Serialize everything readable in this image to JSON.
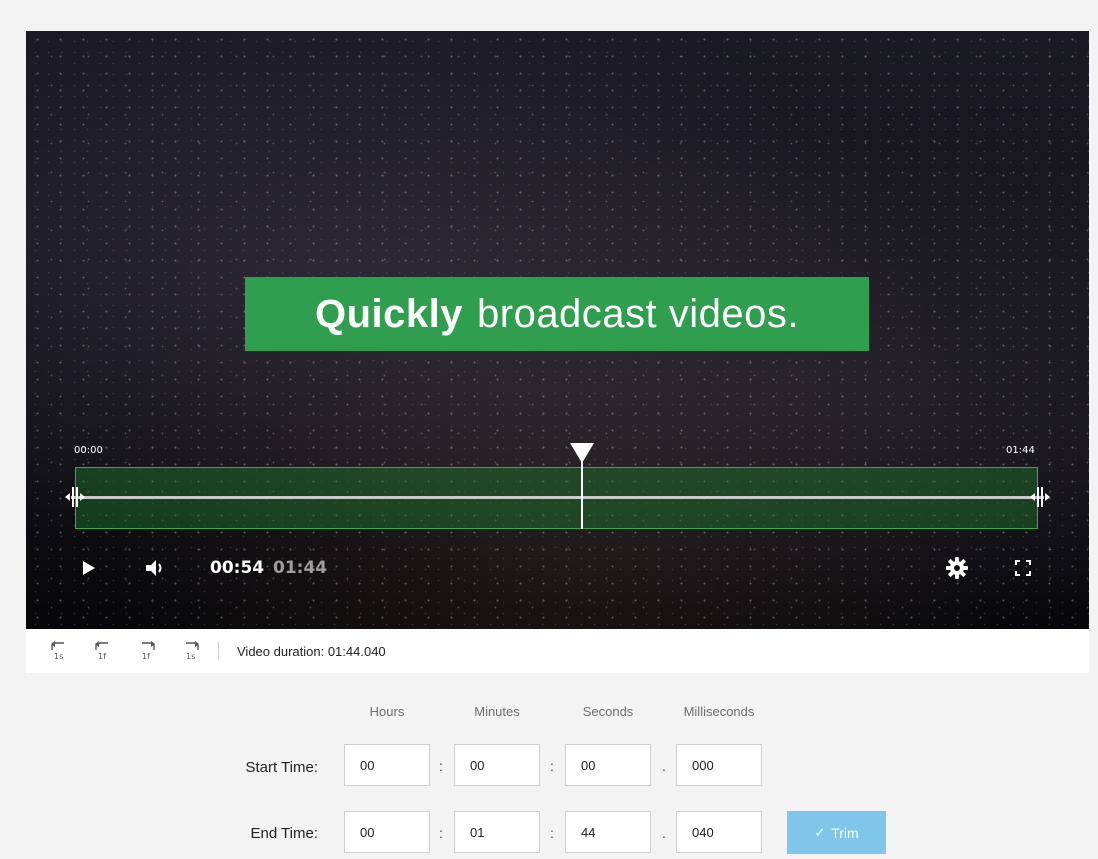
{
  "video": {
    "caption_bold": "Quickly",
    "caption_rest": "broadcast videos.",
    "trim_start_label": "00:00",
    "trim_end_label": "01:44",
    "playhead_fraction": 0.53,
    "current_time": "00:54",
    "total_time": "01:44"
  },
  "controls": {
    "icons": [
      "play-icon",
      "volume-icon",
      "settings-icon",
      "fullscreen-icon"
    ]
  },
  "toolbar": {
    "buttons": [
      {
        "name": "rewind-1s-button",
        "glyph": "1s"
      },
      {
        "name": "rewind-1f-button",
        "glyph": "1f"
      },
      {
        "name": "forward-1f-button",
        "glyph": "1f"
      },
      {
        "name": "forward-1s-button",
        "glyph": "1s"
      }
    ],
    "duration_text": "Video duration: 01:44.040"
  },
  "form": {
    "headers": {
      "hours": "Hours",
      "minutes": "Minutes",
      "seconds": "Seconds",
      "milliseconds": "Milliseconds"
    },
    "start": {
      "label": "Start Time:",
      "hours": "00",
      "minutes": "00",
      "seconds": "00",
      "milliseconds": "000"
    },
    "end": {
      "label": "End Time:",
      "hours": "00",
      "minutes": "01",
      "seconds": "44",
      "milliseconds": "040"
    },
    "sep_colon": ":",
    "sep_dot": ".",
    "trim_label": "Trim",
    "trim_check": "✓"
  },
  "colors": {
    "caption_bg": "#2f9e4e",
    "trim_region": "#2fae4f",
    "trim_button": "#7fc6ea"
  }
}
